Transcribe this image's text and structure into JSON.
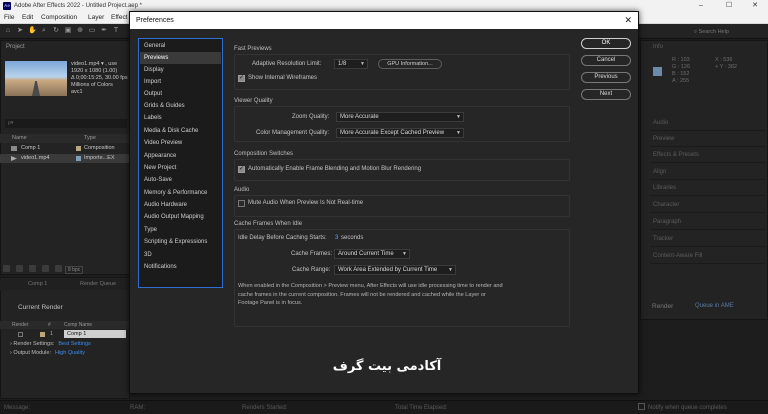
{
  "app": {
    "title": "Adobe After Effects 2022 - Untitled Project.aep *",
    "logo_text": "Ae",
    "menu": [
      "File",
      "Edit",
      "Composition",
      "Layer",
      "Effect"
    ],
    "search_help": "Search Help"
  },
  "project_panel": {
    "tab": "Project",
    "metadata": {
      "name": "video1.mp4 ▾ , use",
      "resolution": "1920 x 1080 (1.00)",
      "duration": "Δ 0;00:15:25, 30.00 fps",
      "colors": "Millions of Colors",
      "codec": "avc1"
    },
    "search_placeholder": "ρ▾",
    "columns": {
      "name": "Name",
      "type": "Type"
    },
    "items": [
      {
        "name": "Comp 1",
        "type": "Composition",
        "swatch_color": "#b9a87a",
        "icon": "composition-icon"
      },
      {
        "name": "video1.mp4",
        "type": "Importe...EX",
        "swatch_color": "#7da0b8",
        "icon": "footage-icon"
      }
    ],
    "bpc": "8 bpc"
  },
  "render_queue": {
    "tabs": [
      "Comp 1",
      "Render Queue"
    ],
    "current_render": "Current Render",
    "columns": {
      "render": "Render",
      "num": "#",
      "comp_name": "Comp Name"
    },
    "row": {
      "num": "1",
      "comp": "Comp 1"
    },
    "render_settings_label": "Render Settings:",
    "render_settings_value": "Best Settings",
    "output_module_label": "Output Module:",
    "output_module_value": "High Quality"
  },
  "status_bar": {
    "message": "Message:",
    "ram": "RAM:",
    "renders_started": "Renders Started:",
    "total_time": "Total Time Elapsed:",
    "notify": "Notify when queue completes"
  },
  "right_panels": {
    "info_tab": "Info",
    "info_values": [
      "R : 103",
      "G : 126",
      "B : 152",
      "A : 255"
    ],
    "coords": [
      "X : 536",
      "+ Y : 382"
    ],
    "items": [
      "Audio",
      "Preview",
      "Effects & Presets",
      "Align",
      "Libraries",
      "Character",
      "Paragraph",
      "Tracker",
      "Content-Aware Fill"
    ],
    "render_label": "Render",
    "queue_label": "Queue in AME"
  },
  "preferences": {
    "title": "Preferences",
    "nav": [
      "General",
      "Previews",
      "Display",
      "Import",
      "Output",
      "Grids & Guides",
      "Labels",
      "Media & Disk Cache",
      "Video Preview",
      "Appearance",
      "New Project",
      "Auto-Save",
      "Memory & Performance",
      "Audio Hardware",
      "Audio Output Mapping",
      "Type",
      "Scripting & Expressions",
      "3D",
      "Notifications"
    ],
    "active_nav": "Previews",
    "fast_previews": {
      "title": "Fast Previews",
      "resolution_label": "Adaptive Resolution Limit:",
      "resolution_value": "1/8",
      "gpu_button": "GPU Information...",
      "show_wireframes": "Show Internal Wireframes",
      "show_wireframes_checked": true
    },
    "viewer_quality": {
      "title": "Viewer Quality",
      "zoom_label": "Zoom Quality:",
      "zoom_value": "More Accurate",
      "color_label": "Color Management Quality:",
      "color_value": "More Accurate Except Cached Preview"
    },
    "composition_switches": {
      "title": "Composition Switches",
      "frame_blending": "Automatically Enable Frame Blending and Motion Blur Rendering",
      "frame_blending_checked": true
    },
    "audio": {
      "title": "Audio",
      "mute": "Mute Audio When Preview Is Not Real-time",
      "mute_checked": false
    },
    "cache_frames": {
      "title": "Cache Frames When Idle",
      "delay_label": "Idle Delay Before Caching Starts:",
      "delay_value": "3",
      "delay_unit": "seconds",
      "cache_frames_label": "Cache Frames:",
      "cache_frames_value": "Around Current Time",
      "cache_range_label": "Cache Range:",
      "cache_range_value": "Work Area Extended by Current Time",
      "description_1": "When enabled in the Composition > Preview menu, After Effects will use idle processing time to render and",
      "description_2": "cache frames in the current composition. Frames will not be rendered and cached while the Layer or",
      "description_3": "Footage Panel is in focus."
    },
    "buttons": {
      "ok": "OK",
      "cancel": "Cancel",
      "previous": "Previous",
      "next": "Next"
    }
  },
  "watermark": "آکادمی بیت گرف"
}
